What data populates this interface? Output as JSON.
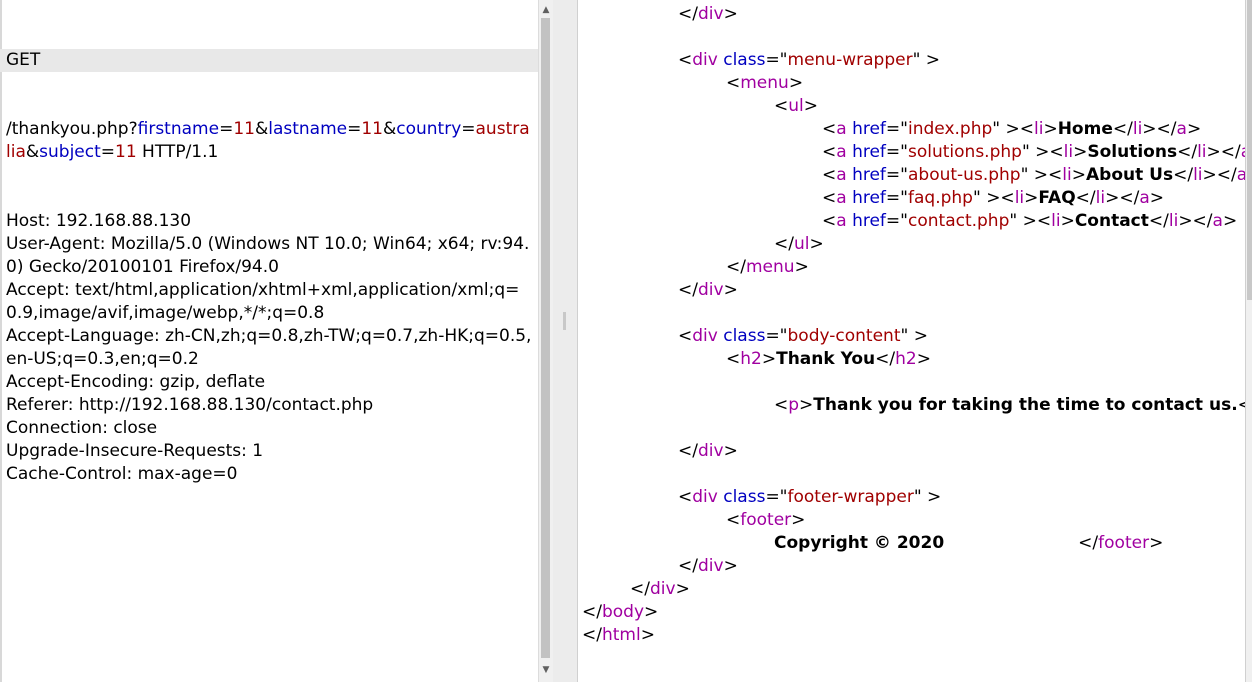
{
  "request": {
    "method": "GET",
    "path": "/thankyou.php?",
    "params": [
      {
        "sep": "",
        "name": "firstname",
        "value": "11"
      },
      {
        "sep": "&",
        "name": "lastname",
        "value": "11"
      },
      {
        "sep": "&",
        "name": "country",
        "value": "australia"
      },
      {
        "sep": "&",
        "name": "subject",
        "value": "11"
      }
    ],
    "protocol": " HTTP/1.1",
    "headers": [
      "Host: 192.168.88.130",
      "User-Agent: Mozilla/5.0 (Windows NT 10.0; Win64; x64; rv:94.0) Gecko/20100101 Firefox/94.0",
      "Accept: text/html,application/xhtml+xml,application/xml;q=0.9,image/avif,image/webp,*/*;q=0.8",
      "Accept-Language: zh-CN,zh;q=0.8,zh-TW;q=0.7,zh-HK;q=0.5,en-US;q=0.3,en;q=0.2",
      "Accept-Encoding: gzip, deflate",
      "Referer: http://192.168.88.130/contact.php",
      "Connection: close",
      "Upgrade-Insecure-Requests: 1",
      "Cache-Control: max-age=0"
    ]
  },
  "response": {
    "lines": [
      {
        "indent": 2,
        "parts": [
          [
            "pun",
            "</"
          ],
          [
            "tag",
            "div"
          ],
          [
            "pun",
            ">"
          ]
        ]
      },
      {
        "indent": 0,
        "parts": []
      },
      {
        "indent": 2,
        "parts": [
          [
            "pun",
            "<"
          ],
          [
            "tag",
            "div "
          ],
          [
            "att",
            "class"
          ],
          [
            "pun",
            "=\""
          ],
          [
            "val",
            "menu-wrapper"
          ],
          [
            "pun",
            "\" >"
          ]
        ]
      },
      {
        "indent": 3,
        "parts": [
          [
            "pun",
            "<"
          ],
          [
            "tag",
            "menu"
          ],
          [
            "pun",
            ">"
          ]
        ]
      },
      {
        "indent": 4,
        "parts": [
          [
            "pun",
            "<"
          ],
          [
            "tag",
            "ul"
          ],
          [
            "pun",
            ">"
          ]
        ]
      },
      {
        "indent": 5,
        "parts": [
          [
            "pun",
            "<"
          ],
          [
            "tag",
            "a "
          ],
          [
            "att",
            "href"
          ],
          [
            "pun",
            "=\""
          ],
          [
            "val",
            "index.php"
          ],
          [
            "pun",
            "\" ><"
          ],
          [
            "tag",
            "li"
          ],
          [
            "pun",
            ">"
          ],
          [
            "txt",
            "Home"
          ],
          [
            "pun",
            "</"
          ],
          [
            "tag",
            "li"
          ],
          [
            "pun",
            "></"
          ],
          [
            "tag",
            "a"
          ],
          [
            "pun",
            ">"
          ]
        ]
      },
      {
        "indent": 5,
        "parts": [
          [
            "pun",
            "<"
          ],
          [
            "tag",
            "a "
          ],
          [
            "att",
            "href"
          ],
          [
            "pun",
            "=\""
          ],
          [
            "val",
            "solutions.php"
          ],
          [
            "pun",
            "\" ><"
          ],
          [
            "tag",
            "li"
          ],
          [
            "pun",
            ">"
          ],
          [
            "txt",
            "Solutions"
          ],
          [
            "pun",
            "</"
          ],
          [
            "tag",
            "li"
          ],
          [
            "pun",
            "></"
          ],
          [
            "tag",
            "a"
          ],
          [
            "pun",
            ">"
          ]
        ]
      },
      {
        "indent": 5,
        "parts": [
          [
            "pun",
            "<"
          ],
          [
            "tag",
            "a "
          ],
          [
            "att",
            "href"
          ],
          [
            "pun",
            "=\""
          ],
          [
            "val",
            "about-us.php"
          ],
          [
            "pun",
            "\" ><"
          ],
          [
            "tag",
            "li"
          ],
          [
            "pun",
            ">"
          ],
          [
            "txt",
            "About Us"
          ],
          [
            "pun",
            "</"
          ],
          [
            "tag",
            "li"
          ],
          [
            "pun",
            "></"
          ],
          [
            "tag",
            "a"
          ],
          [
            "pun",
            ">"
          ]
        ]
      },
      {
        "indent": 5,
        "parts": [
          [
            "pun",
            "<"
          ],
          [
            "tag",
            "a "
          ],
          [
            "att",
            "href"
          ],
          [
            "pun",
            "=\""
          ],
          [
            "val",
            "faq.php"
          ],
          [
            "pun",
            "\" ><"
          ],
          [
            "tag",
            "li"
          ],
          [
            "pun",
            ">"
          ],
          [
            "txt",
            "FAQ"
          ],
          [
            "pun",
            "</"
          ],
          [
            "tag",
            "li"
          ],
          [
            "pun",
            "></"
          ],
          [
            "tag",
            "a"
          ],
          [
            "pun",
            ">"
          ]
        ]
      },
      {
        "indent": 5,
        "parts": [
          [
            "pun",
            "<"
          ],
          [
            "tag",
            "a "
          ],
          [
            "att",
            "href"
          ],
          [
            "pun",
            "=\""
          ],
          [
            "val",
            "contact.php"
          ],
          [
            "pun",
            "\" ><"
          ],
          [
            "tag",
            "li"
          ],
          [
            "pun",
            ">"
          ],
          [
            "txt",
            "Contact"
          ],
          [
            "pun",
            "</"
          ],
          [
            "tag",
            "li"
          ],
          [
            "pun",
            "></"
          ],
          [
            "tag",
            "a"
          ],
          [
            "pun",
            ">"
          ]
        ]
      },
      {
        "indent": 4,
        "parts": [
          [
            "pun",
            "</"
          ],
          [
            "tag",
            "ul"
          ],
          [
            "pun",
            ">"
          ]
        ]
      },
      {
        "indent": 3,
        "parts": [
          [
            "pun",
            "</"
          ],
          [
            "tag",
            "menu"
          ],
          [
            "pun",
            ">"
          ]
        ]
      },
      {
        "indent": 2,
        "parts": [
          [
            "pun",
            "</"
          ],
          [
            "tag",
            "div"
          ],
          [
            "pun",
            ">"
          ]
        ]
      },
      {
        "indent": 0,
        "parts": []
      },
      {
        "indent": 2,
        "parts": [
          [
            "pun",
            "<"
          ],
          [
            "tag",
            "div "
          ],
          [
            "att",
            "class"
          ],
          [
            "pun",
            "=\""
          ],
          [
            "val",
            "body-content"
          ],
          [
            "pun",
            "\" >"
          ]
        ]
      },
      {
        "indent": 3,
        "parts": [
          [
            "pun",
            "<"
          ],
          [
            "tag",
            "h2"
          ],
          [
            "pun",
            ">"
          ],
          [
            "txt",
            "Thank You"
          ],
          [
            "pun",
            "</"
          ],
          [
            "tag",
            "h2"
          ],
          [
            "pun",
            ">"
          ]
        ]
      },
      {
        "indent": 0,
        "parts": []
      },
      {
        "indent": 4,
        "parts": [
          [
            "pun",
            "<"
          ],
          [
            "tag",
            "p"
          ],
          [
            "pun",
            ">"
          ],
          [
            "txt",
            "Thank you for taking the time to contact us."
          ],
          [
            "pun",
            "</"
          ],
          [
            "tag",
            "p"
          ],
          [
            "pun",
            ">"
          ]
        ]
      },
      {
        "indent": 0,
        "parts": []
      },
      {
        "indent": 2,
        "parts": [
          [
            "pun",
            "</"
          ],
          [
            "tag",
            "div"
          ],
          [
            "pun",
            ">"
          ]
        ]
      },
      {
        "indent": 0,
        "parts": []
      },
      {
        "indent": 2,
        "parts": [
          [
            "pun",
            "<"
          ],
          [
            "tag",
            "div "
          ],
          [
            "att",
            "class"
          ],
          [
            "pun",
            "=\""
          ],
          [
            "val",
            "footer-wrapper"
          ],
          [
            "pun",
            "\" >"
          ]
        ]
      },
      {
        "indent": 3,
        "parts": [
          [
            "pun",
            "<"
          ],
          [
            "tag",
            "footer"
          ],
          [
            "pun",
            ">"
          ]
        ]
      },
      {
        "indent": 4,
        "parts": [
          [
            "txt",
            "Copyright © 2020"
          ],
          [
            "gap",
            ""
          ],
          [
            "pun",
            "</"
          ],
          [
            "tag",
            "footer"
          ],
          [
            "pun",
            ">"
          ]
        ]
      },
      {
        "indent": 2,
        "parts": [
          [
            "pun",
            "</"
          ],
          [
            "tag",
            "div"
          ],
          [
            "pun",
            ">"
          ]
        ]
      },
      {
        "indent": 1,
        "parts": [
          [
            "pun",
            "</"
          ],
          [
            "tag",
            "div"
          ],
          [
            "pun",
            ">"
          ]
        ]
      },
      {
        "indent": 0,
        "parts": [
          [
            "pun",
            "</"
          ],
          [
            "tag",
            "body"
          ],
          [
            "pun",
            ">"
          ]
        ]
      },
      {
        "indent": 0,
        "parts": [
          [
            "pun",
            "</"
          ],
          [
            "tag",
            "html"
          ],
          [
            "pun",
            ">"
          ]
        ]
      }
    ]
  }
}
